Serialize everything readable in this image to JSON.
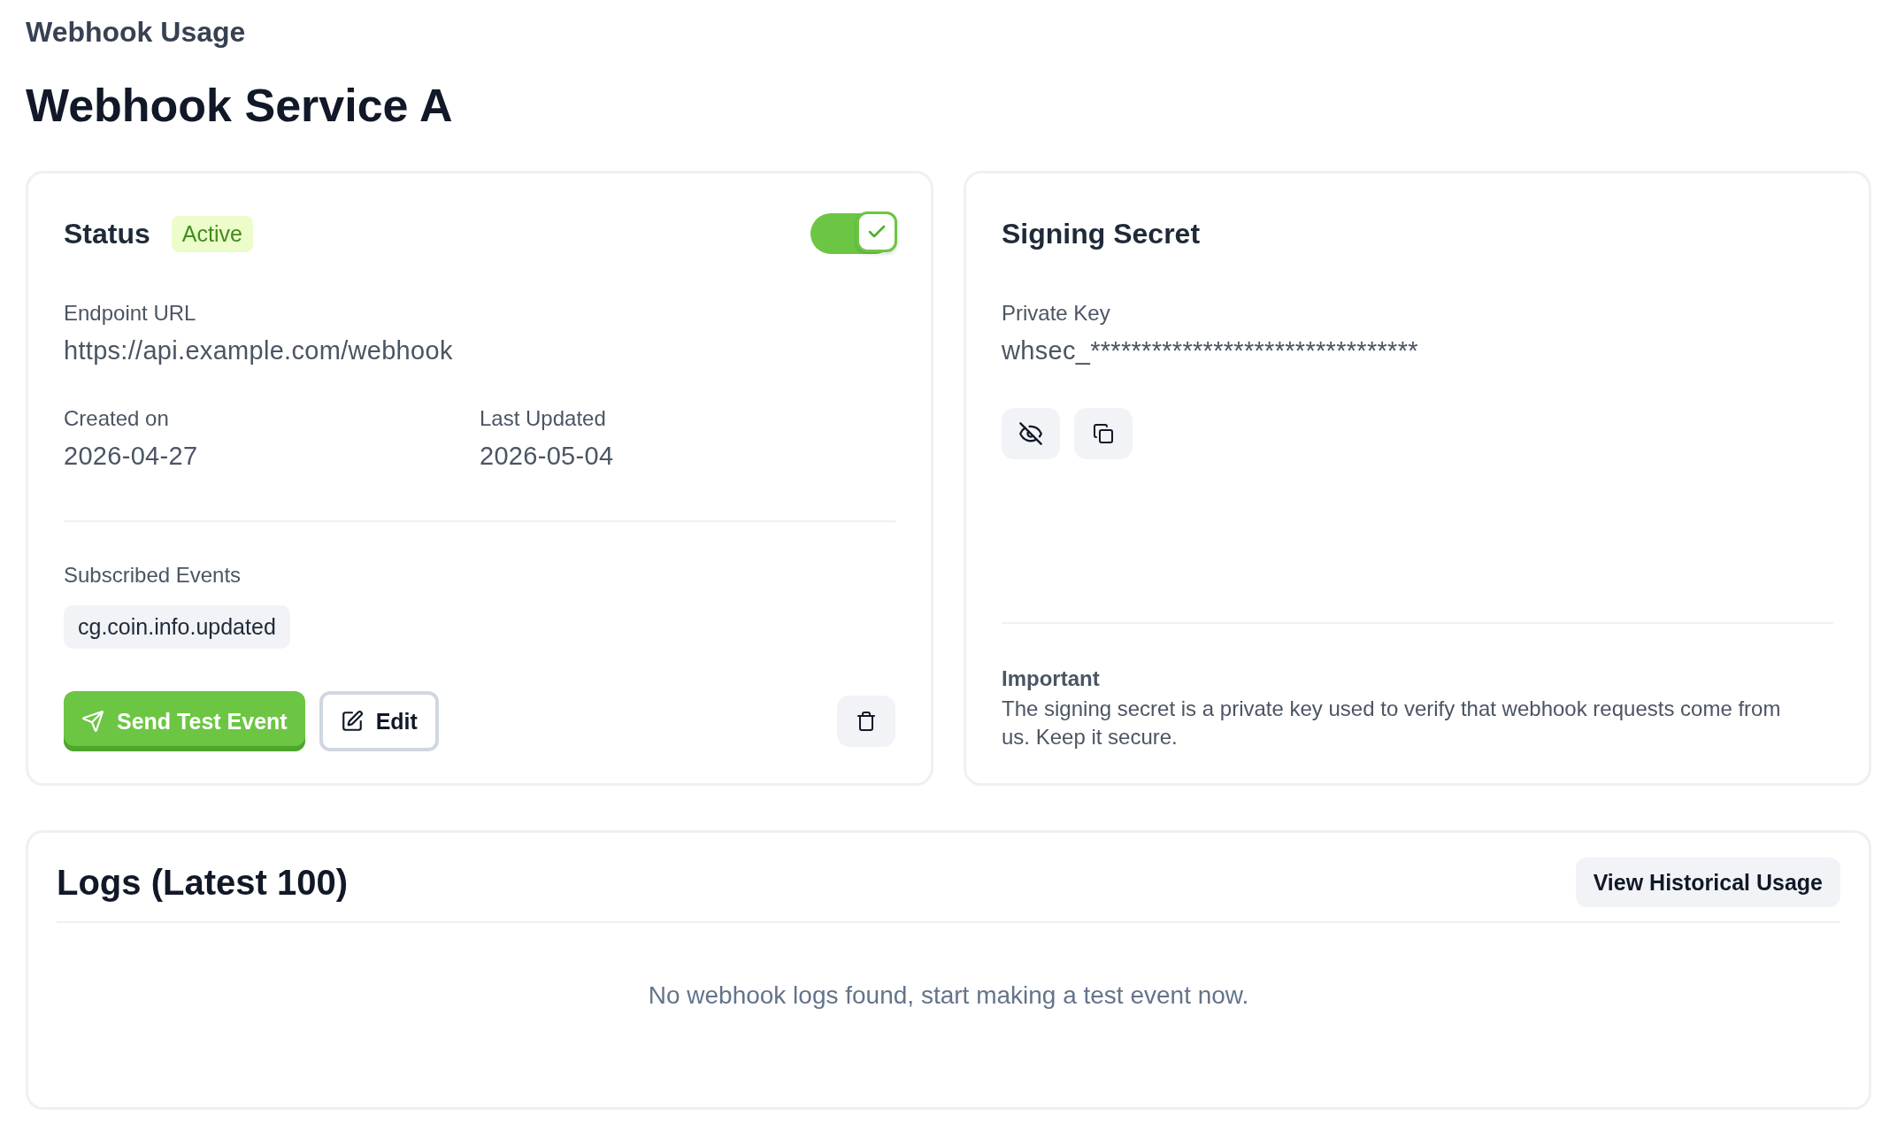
{
  "breadcrumb": "Webhook Usage",
  "title": "Webhook Service A",
  "status_card": {
    "title": "Status",
    "badge": "Active",
    "enabled": true,
    "endpoint": {
      "label": "Endpoint URL",
      "value": "https://api.example.com/webhook"
    },
    "dates": [
      {
        "label": "Created on",
        "value": "2026-04-27"
      },
      {
        "label": "Last Updated",
        "value": "2026-05-04"
      }
    ],
    "events_label": "Subscribed Events",
    "events": [
      "cg.coin.info.updated"
    ],
    "buttons": [
      {
        "kind": "primary",
        "label": "Send Test Event"
      },
      {
        "kind": "outline",
        "label": "Edit"
      }
    ]
  },
  "secret_card": {
    "title": "Signing Secret",
    "key_label": "Private Key",
    "key_value": "whsec_********************************",
    "revealed": false,
    "note_title": "Important",
    "note_text": "The signing secret is a private key used to verify that webhook requests come from us. Keep it secure."
  },
  "logs": {
    "title": "Logs (Latest 100)",
    "button": "View Historical Usage",
    "empty_text": "No webhook logs found, start making a test event now."
  }
}
